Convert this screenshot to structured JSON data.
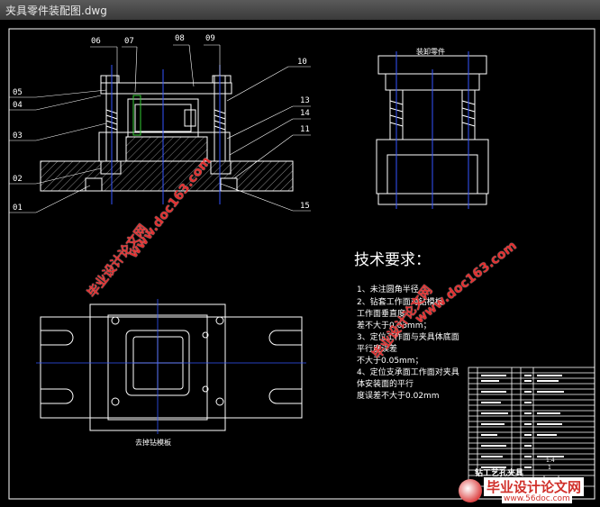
{
  "window": {
    "title": "夹具零件装配图.dwg"
  },
  "part_labels": [
    "06",
    "07",
    "08",
    "09",
    "10",
    "05",
    "04",
    "03",
    "13",
    "14",
    "11",
    "02",
    "01",
    "15"
  ],
  "side_view": {
    "title": "装卸零件"
  },
  "plan_view": {
    "title": "去掉钻模板"
  },
  "tech_requirements": {
    "title": "技术要求：",
    "lines": [
      "1、未注圆角半径",
      "2、钻套工作面对钻模板",
      "工作面垂直度",
      "差不大于0.03mm；",
      "3、定位工作面与夹具体底面",
      "平行度误差",
      "不大于0.05mm；",
      "4、定位支承面工作面对夹具",
      "体安装面的平行",
      "度误差不大于0.02mm"
    ]
  },
  "title_block": {
    "name": "钻工艺孔夹具",
    "scale": "1:4",
    "sheet": "1"
  },
  "watermarks": [
    "毕业设计论文网",
    "www.doc163.com"
  ],
  "logo": {
    "name": "毕业设计论文网",
    "url": "www.56doc.com"
  },
  "colors": {
    "background": "#000000",
    "line": "#ffffff",
    "hatch": "#cccccc",
    "center": "#3355ff",
    "watermark": "#e23030",
    "green": "#33cc33"
  }
}
